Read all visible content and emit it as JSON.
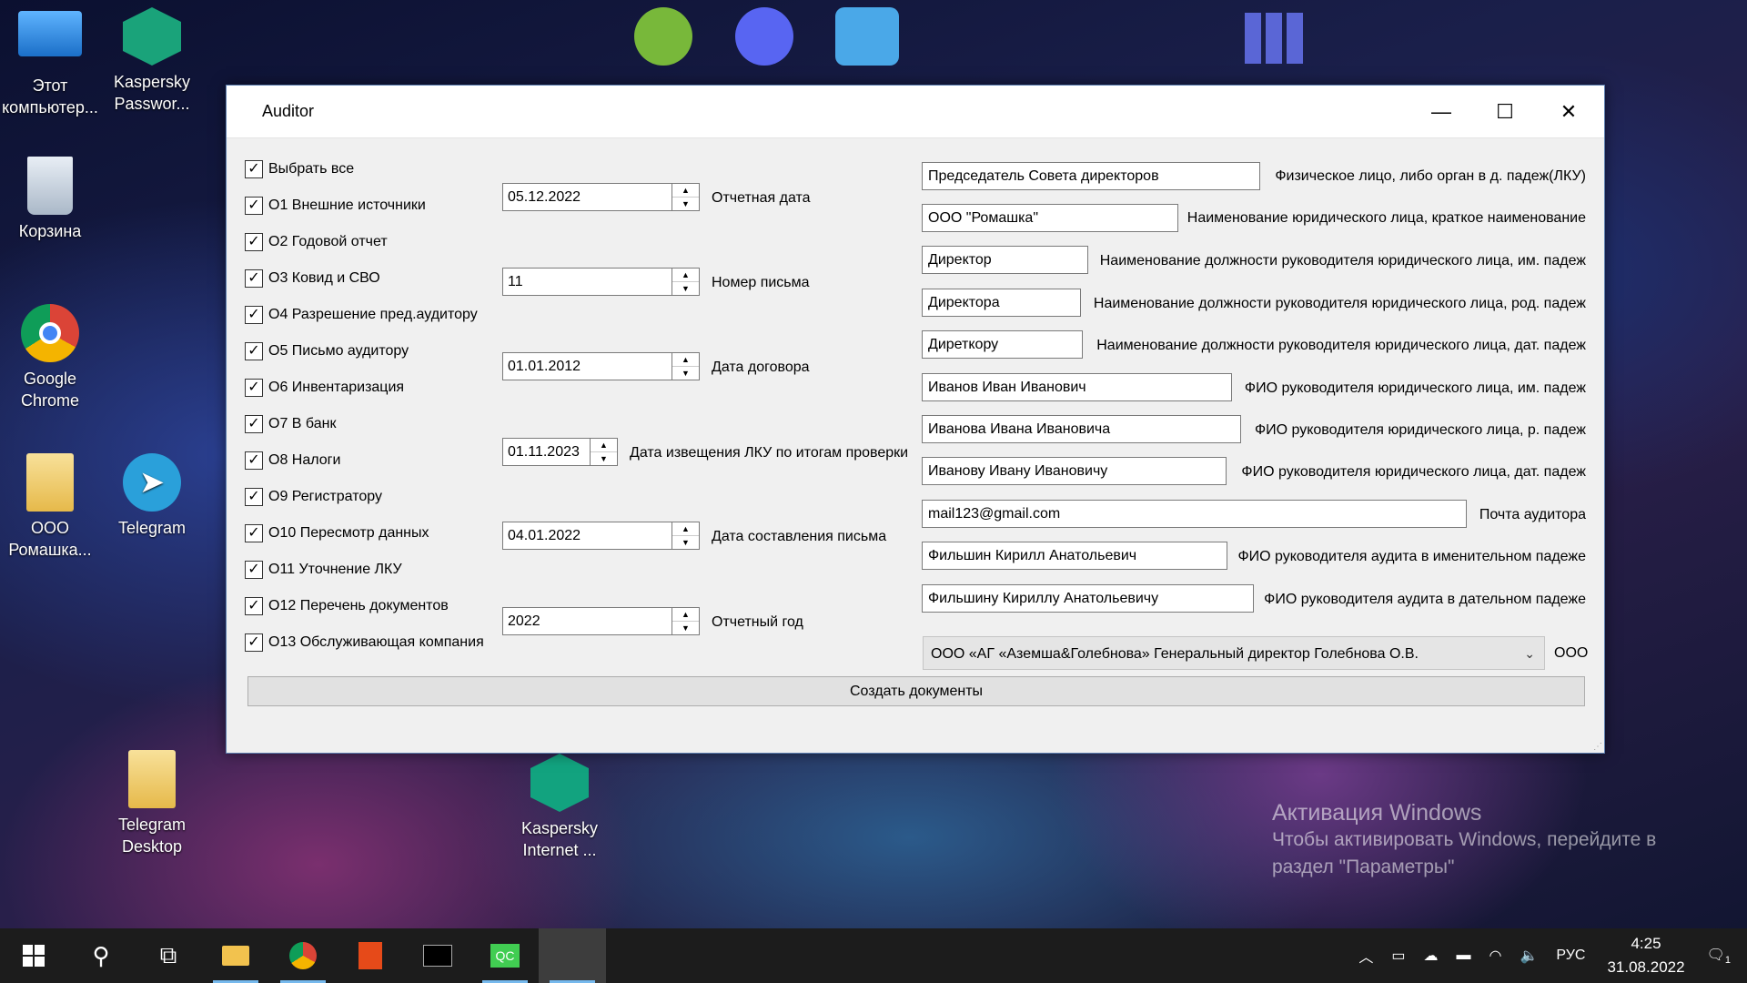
{
  "desktop": {
    "icons": [
      {
        "label": "Этот компьютер...",
        "icon": "computer-icon"
      },
      {
        "label": "Kaspersky Passwor...",
        "icon": "kaspersky-password-icon"
      },
      {
        "label": "Корзина",
        "icon": "recycle-bin-icon"
      },
      {
        "label": "Google Chrome",
        "icon": "chrome-icon"
      },
      {
        "label": "ООО Ромашка...",
        "icon": "folder-icon"
      },
      {
        "label": "Telegram",
        "icon": "telegram-icon"
      },
      {
        "label": "Telegram Desktop",
        "icon": "folder-icon"
      },
      {
        "label": "Kaspersky Internet ...",
        "icon": "kaspersky-internet-icon"
      }
    ],
    "watermark": {
      "title": "Активация Windows",
      "text": "Чтобы активировать Windows, перейдите в раздел \"Параметры\""
    }
  },
  "window": {
    "title": "Auditor",
    "minimize": "—",
    "maximize": "☐",
    "close": "✕"
  },
  "checkboxes": [
    {
      "label": "Выбрать все",
      "checked": true
    },
    {
      "label": "О1 Внешние источники",
      "checked": true
    },
    {
      "label": "О2 Годовой отчет",
      "checked": true
    },
    {
      "label": "О3 Ковид и СВО",
      "checked": true
    },
    {
      "label": "О4 Разрешение пред.аудитору",
      "checked": true
    },
    {
      "label": "О5 Письмо аудитору",
      "checked": true
    },
    {
      "label": "О6 Инвентаризация",
      "checked": true
    },
    {
      "label": "О7 В банк",
      "checked": true
    },
    {
      "label": "О8 Налоги",
      "checked": true
    },
    {
      "label": "О9 Регистратору",
      "checked": true
    },
    {
      "label": "О10 Пересмотр данных",
      "checked": true
    },
    {
      "label": "О11 Уточнение ЛКУ",
      "checked": true
    },
    {
      "label": "О12 Перечень документов",
      "checked": true
    },
    {
      "label": "О13 Обслуживающая компания",
      "checked": true
    }
  ],
  "spinners": [
    {
      "value": "05.12.2022",
      "label": "Отчетная дата"
    },
    {
      "value": "11",
      "label": "Номер письма"
    },
    {
      "value": "01.01.2012",
      "label": "Дата договора"
    },
    {
      "value": "01.11.2023",
      "label": "Дата извещения ЛКУ по итогам проверки"
    },
    {
      "value": "04.01.2022",
      "label": "Дата составления письма"
    },
    {
      "value": "2022",
      "label": "Отчетный год"
    }
  ],
  "fields": [
    {
      "value": "Председатель Совета директоров",
      "label": "Физическое лицо, либо орган в д. падеж(ЛКУ)"
    },
    {
      "value": "ООО \"Ромашка\"",
      "label": "Наименование юридического лица, краткое наименование"
    },
    {
      "value": "Директор",
      "label": "Наименование должности руководителя юридического лица, им. падеж"
    },
    {
      "value": "Директора",
      "label": "Наименование должности руководителя юридического лица, род. падеж"
    },
    {
      "value": "Диреткору",
      "label": "Наименование должности руководителя юридического лица, дат. падеж"
    },
    {
      "value": "Иванов Иван Иванович",
      "label": "ФИО руководителя юридического лица, им. падеж"
    },
    {
      "value": "Иванова Ивана Ивановича",
      "label": "ФИО руководителя юридического лица, р. падеж"
    },
    {
      "value": "Иванову Ивану Ивановичу",
      "label": "ФИО руководителя юридического лица, дат. падеж"
    },
    {
      "value": "mail123@gmail.com",
      "label": "Почта аудитора"
    },
    {
      "value": "Фильшин Кирилл Анатольевич",
      "label": "ФИО руководителя аудита в именительном падеже"
    },
    {
      "value": "Фильшину Кириллу Анатольевичу",
      "label": "ФИО руководителя аудита в дательном падеже"
    }
  ],
  "company_select": {
    "value": "ООО «АГ «Аземша&Голебнова» Генеральный директор Голебнова О.В.",
    "label": "ООО"
  },
  "create_button": "Создать документы",
  "taskbar": {
    "lang": "РУС",
    "time": "4:25",
    "date": "31.08.2022",
    "notifications": "1"
  }
}
